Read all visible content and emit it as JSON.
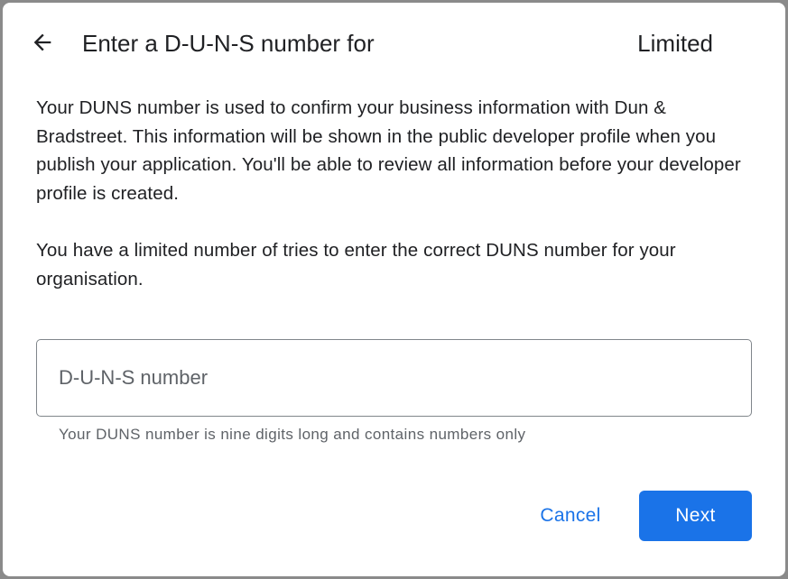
{
  "dialog": {
    "title": "Enter a D-U-N-S number for",
    "title_right": "Limited",
    "paragraph1": "Your DUNS number is used to confirm your business information with Dun & Bradstreet. This information will be shown in the public developer profile when you publish your application. You'll be able to review all information before your developer profile is created.",
    "paragraph2": "You have a limited number of tries to enter the correct DUNS number for your organisation.",
    "field": {
      "placeholder": "D-U-N-S number",
      "value": "",
      "helper": "Your DUNS number is nine digits long and contains numbers only"
    },
    "buttons": {
      "cancel": "Cancel",
      "next": "Next"
    }
  },
  "colors": {
    "accent": "#1a73e8",
    "text": "#202124",
    "secondary_text": "#5f6368",
    "border": "#80868b"
  },
  "icons": {
    "back": "arrow-back-icon"
  }
}
